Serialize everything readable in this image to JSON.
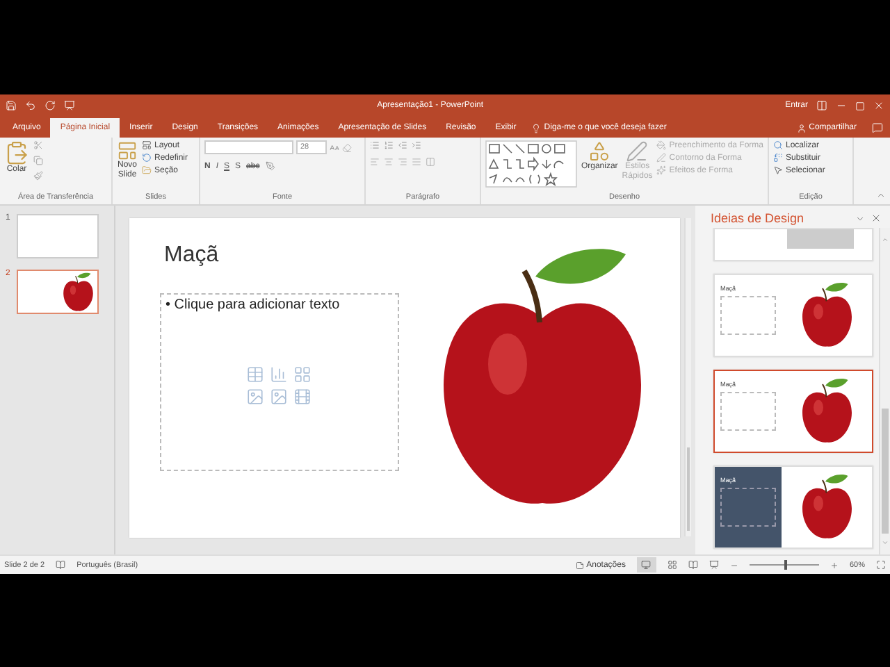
{
  "window": {
    "title": "Apresentação1 - PowerPoint",
    "sign_in": "Entrar"
  },
  "tabs": [
    {
      "label": "Arquivo",
      "selected": false
    },
    {
      "label": "Página Inicial",
      "selected": true
    },
    {
      "label": "Inserir",
      "selected": false
    },
    {
      "label": "Design",
      "selected": false
    },
    {
      "label": "Transições",
      "selected": false
    },
    {
      "label": "Animações",
      "selected": false
    },
    {
      "label": "Apresentação de Slides",
      "selected": false
    },
    {
      "label": "Revisão",
      "selected": false
    },
    {
      "label": "Exibir",
      "selected": false
    }
  ],
  "tell_me": {
    "placeholder": "Diga-me o que você deseja fazer"
  },
  "share": "Compartilhar",
  "ribbon": {
    "clipboard": {
      "paste": "Colar",
      "label": "Área de Transferência"
    },
    "slides": {
      "new_slide": [
        "Novo",
        "Slide"
      ],
      "layout": "Layout",
      "reset": "Redefinir",
      "section": "Seção",
      "label": "Slides"
    },
    "font": {
      "size": "28",
      "format_buttons": [
        "N",
        "I",
        "S",
        "S",
        "abc"
      ],
      "label": "Fonte"
    },
    "paragraph": {
      "label": "Parágrafo"
    },
    "drawing": {
      "arrange": "Organizar",
      "quick_styles": [
        "Estilos",
        "Rápidos"
      ],
      "fill": "Preenchimento da Forma",
      "outline": "Contorno da Forma",
      "effects": "Efeitos de Forma",
      "label": "Desenho"
    },
    "editing": {
      "find": "Localizar",
      "replace": "Substituir",
      "select": "Selecionar",
      "label": "Edição"
    }
  },
  "slide_thumbnails": [
    {
      "number": "1",
      "selected": false,
      "kind": "title"
    },
    {
      "number": "2",
      "selected": true,
      "kind": "apple"
    }
  ],
  "slide": {
    "title": "Maçã",
    "body": "• Clique para adicionar texto"
  },
  "design_pane": {
    "title": "Ideias de Design",
    "ideas": [
      {
        "kind": "cropped",
        "selected": false
      },
      {
        "kind": "white",
        "title": "Maçã",
        "selected": false
      },
      {
        "kind": "white",
        "title": "Maçã",
        "selected": true
      },
      {
        "kind": "dark",
        "title": "Maçã",
        "selected": false
      }
    ]
  },
  "status_bar": {
    "slide": "Slide 2 de 2",
    "language": "Português (Brasil)",
    "notes": "Anotações",
    "zoom": "60%",
    "zoom_slider": {
      "level": 0.5
    }
  }
}
